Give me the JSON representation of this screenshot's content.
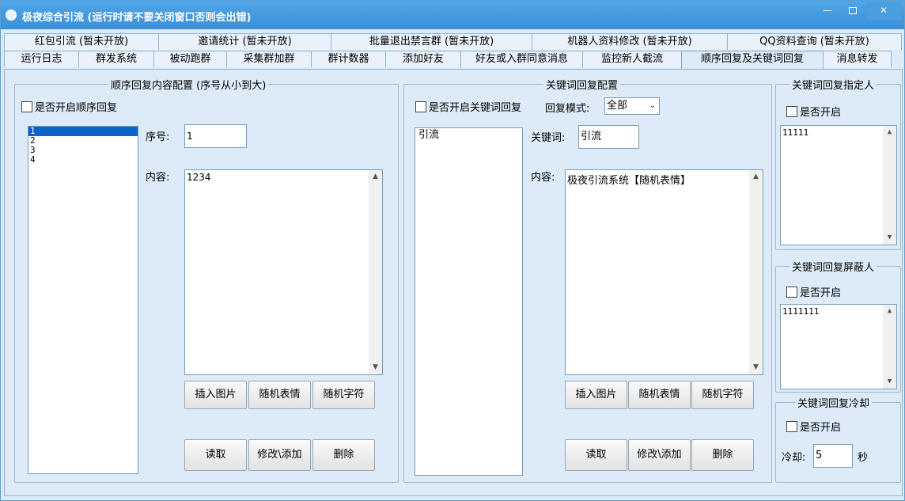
{
  "window": {
    "title": "极夜综合引流 (运行时请不要关闭窗口否则会出错)",
    "minimize_glyph": "—",
    "close_glyph": "✕"
  },
  "tabs_row1": [
    {
      "label": "红包引流 (暂未开放)"
    },
    {
      "label": "邀请统计 (暂未开放)"
    },
    {
      "label": "批量退出禁言群 (暂未开放)"
    },
    {
      "label": "机器人资料修改 (暂未开放)"
    },
    {
      "label": "QQ资料查询 (暂未开放)"
    }
  ],
  "tabs_row2": [
    {
      "label": "运行日志"
    },
    {
      "label": "群发系统"
    },
    {
      "label": "被动跑群"
    },
    {
      "label": "采集群加群"
    },
    {
      "label": "群计数器"
    },
    {
      "label": "添加好友"
    },
    {
      "label": "好友或入群同意消息"
    },
    {
      "label": "监控新人截流"
    },
    {
      "label": "顺序回复及关键词回复"
    },
    {
      "label": "消息转发"
    }
  ],
  "active_tab": "顺序回复及关键词回复",
  "sequence": {
    "title": "顺序回复内容配置 (序号从小到大)",
    "enable_label": "是否开启顺序回复",
    "list_items": [
      "1",
      "2",
      "3",
      "4"
    ],
    "selected_index": 0,
    "number_label": "序号:",
    "number_value": "1",
    "content_label": "内容:",
    "content_value": "1234",
    "insert_image": "插入图片",
    "random_emoji": "随机表情",
    "random_char": "随机字符",
    "read": "读取",
    "modify_add": "修改\\添加",
    "delete": "删除"
  },
  "keyword": {
    "title": "关键词回复配置",
    "enable_label": "是否开启关键词回复",
    "mode_label": "回复模式:",
    "mode_value": "全部",
    "list_items": [
      "引流"
    ],
    "keyword_label": "关键词:",
    "keyword_value": "引流",
    "content_label": "内容:",
    "content_value": "极夜引流系统【随机表情】",
    "insert_image": "插入图片",
    "random_emoji": "随机表情",
    "random_char": "随机字符",
    "read": "读取",
    "modify_add": "修改\\添加",
    "delete": "删除"
  },
  "designate": {
    "title": "关键词回复指定人",
    "enable_label": "是否开启",
    "value": "11111"
  },
  "block": {
    "title": "关键词回复屏蔽人",
    "enable_label": "是否开启",
    "value": "1111111"
  },
  "cooldown": {
    "title": "关键词回复冷却",
    "enable_label": "是否开启",
    "cool_label": "冷却:",
    "cool_value": "5",
    "unit": "秒"
  },
  "colors": {
    "titlebar": "#4fa6e8",
    "panel": "#dcebf7",
    "selection": "#0a64c8"
  }
}
